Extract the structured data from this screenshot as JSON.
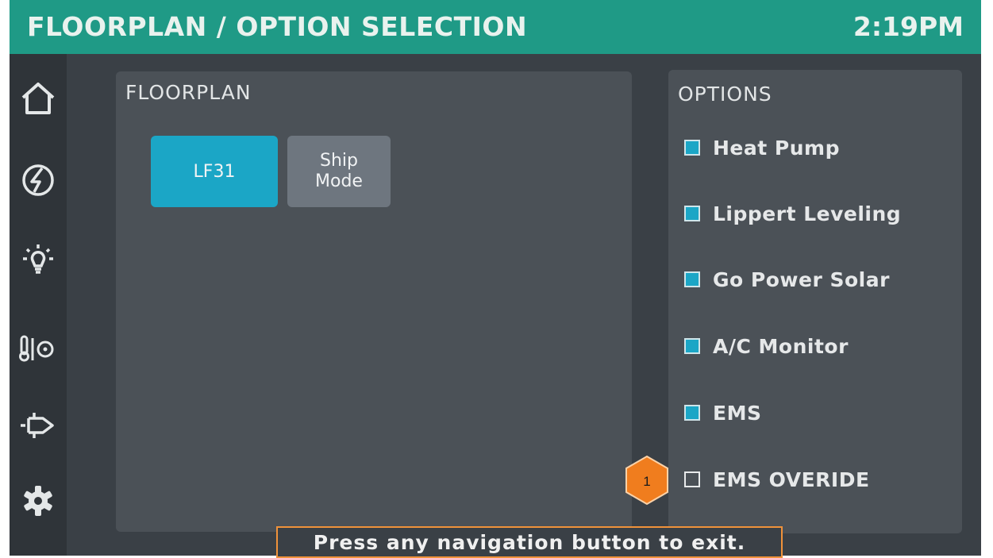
{
  "header": {
    "title": "FLOORPLAN / OPTION SELECTION",
    "time": "2:19PM"
  },
  "floorplan": {
    "title": "FLOORPLAN",
    "buttons": [
      {
        "label": "LF31",
        "selected": true
      },
      {
        "label": "Ship Mode",
        "selected": false
      }
    ]
  },
  "options": {
    "title": "OPTIONS",
    "items": [
      {
        "label": "Heat Pump",
        "checked": true
      },
      {
        "label": "Lippert Leveling",
        "checked": true
      },
      {
        "label": "Go Power Solar",
        "checked": true
      },
      {
        "label": "A/C Monitor",
        "checked": true
      },
      {
        "label": "EMS",
        "checked": true
      },
      {
        "label": "EMS OVERIDE",
        "checked": false
      }
    ]
  },
  "callout": {
    "number": "1"
  },
  "footer": {
    "message": "Press any navigation button to exit."
  },
  "nav": [
    "home-icon",
    "power-icon",
    "light-icon",
    "climate-icon",
    "generator-icon",
    "settings-icon"
  ],
  "colors": {
    "header": "#1f9a86",
    "accent": "#1ba6c6",
    "callout": "#f07d1e",
    "callout_border": "#f0923a"
  }
}
